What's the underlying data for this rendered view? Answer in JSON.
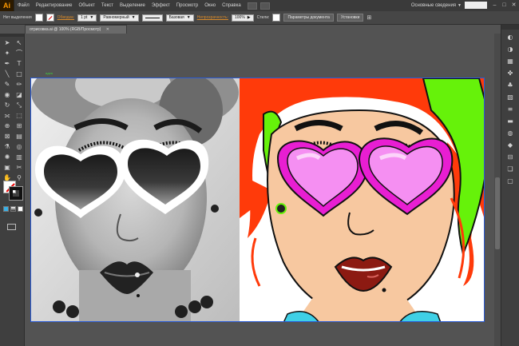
{
  "app": {
    "logo": "Ai"
  },
  "menu": {
    "items": [
      "Файл",
      "Редактирование",
      "Объект",
      "Текст",
      "Выделение",
      "Эффект",
      "Просмотр",
      "Окно",
      "Справка"
    ],
    "workspace": "Основные сведения"
  },
  "window_controls": [
    "–",
    "□",
    "✕"
  ],
  "control_bar": {
    "selection_status": "Нет выделения",
    "stroke_label": "Обводка:",
    "stroke_weight": "1 pt",
    "stroke_profile": "Равномерный",
    "brush": "Базовая",
    "opacity_label": "Непрозрачность:",
    "opacity_value": "100%",
    "styles_label": "Стили:",
    "doc_settings_button": "Параметры документа",
    "preferences_button": "Установки"
  },
  "document_tab": {
    "title": "отрисовка.ai @ 100% (RGB/Просмотр)",
    "close": "✕"
  },
  "artboard": {
    "label": "идея"
  },
  "tools": [
    {
      "name": "selection-tool-icon",
      "glyph": "➤"
    },
    {
      "name": "direct-selection-tool-icon",
      "glyph": "↖"
    },
    {
      "name": "magic-wand-tool-icon",
      "glyph": "✦"
    },
    {
      "name": "lasso-tool-icon",
      "glyph": "⌒"
    },
    {
      "name": "pen-tool-icon",
      "glyph": "✒"
    },
    {
      "name": "type-tool-icon",
      "glyph": "T"
    },
    {
      "name": "line-tool-icon",
      "glyph": "╲"
    },
    {
      "name": "rectangle-tool-icon",
      "glyph": "□"
    },
    {
      "name": "paintbrush-tool-icon",
      "glyph": "✎"
    },
    {
      "name": "pencil-tool-icon",
      "glyph": "✏"
    },
    {
      "name": "blob-brush-tool-icon",
      "glyph": "◉"
    },
    {
      "name": "eraser-tool-icon",
      "glyph": "◪"
    },
    {
      "name": "rotate-tool-icon",
      "glyph": "↻"
    },
    {
      "name": "scale-tool-icon",
      "glyph": "⤡"
    },
    {
      "name": "width-tool-icon",
      "glyph": "⟗"
    },
    {
      "name": "free-transform-tool-icon",
      "glyph": "⬚"
    },
    {
      "name": "shape-builder-tool-icon",
      "glyph": "⊕"
    },
    {
      "name": "perspective-grid-tool-icon",
      "glyph": "⊞"
    },
    {
      "name": "mesh-tool-icon",
      "glyph": "⊠"
    },
    {
      "name": "gradient-tool-icon",
      "glyph": "▤"
    },
    {
      "name": "eyedropper-tool-icon",
      "glyph": "⚗"
    },
    {
      "name": "blend-tool-icon",
      "glyph": "◎"
    },
    {
      "name": "symbol-sprayer-tool-icon",
      "glyph": "✺"
    },
    {
      "name": "column-graph-tool-icon",
      "glyph": "▥"
    },
    {
      "name": "artboard-tool-icon",
      "glyph": "▣"
    },
    {
      "name": "slice-tool-icon",
      "glyph": "✂"
    },
    {
      "name": "hand-tool-icon",
      "glyph": "✋"
    },
    {
      "name": "zoom-tool-icon",
      "glyph": "⚲"
    }
  ],
  "right_panel_icons": [
    {
      "name": "color-panel-icon",
      "glyph": "◐"
    },
    {
      "name": "color-guide-icon",
      "glyph": "◑"
    },
    {
      "name": "swatches-panel-icon",
      "glyph": "▦"
    },
    {
      "name": "brushes-panel-icon",
      "glyph": "✤"
    },
    {
      "name": "symbols-panel-icon",
      "glyph": "♣"
    },
    {
      "name": "graphic-styles-icon",
      "glyph": "▧"
    },
    {
      "name": "stroke-panel-icon",
      "glyph": "≡"
    },
    {
      "name": "gradient-panel-icon",
      "glyph": "▬"
    },
    {
      "name": "transparency-panel-icon",
      "glyph": "◍"
    },
    {
      "name": "appearance-panel-icon",
      "glyph": "◆"
    },
    {
      "name": "align-panel-icon",
      "glyph": "⊟"
    },
    {
      "name": "layers-panel-icon",
      "glyph": "❏"
    },
    {
      "name": "artboards-panel-icon",
      "glyph": "▢"
    }
  ],
  "colors": {
    "ui_dark": "#3a3a3a",
    "canvas_bg": "#535353",
    "artboard_border": "#2a5bd6",
    "hair_orange": "#ff3a0a",
    "headband_green": "#66f20a",
    "glasses_magenta": "#e81ed2",
    "lens_pink": "#f58ff2",
    "skin": "#f7c8a0",
    "lips_red": "#8c1a12",
    "necklace_cyan": "#3fd0e6"
  }
}
